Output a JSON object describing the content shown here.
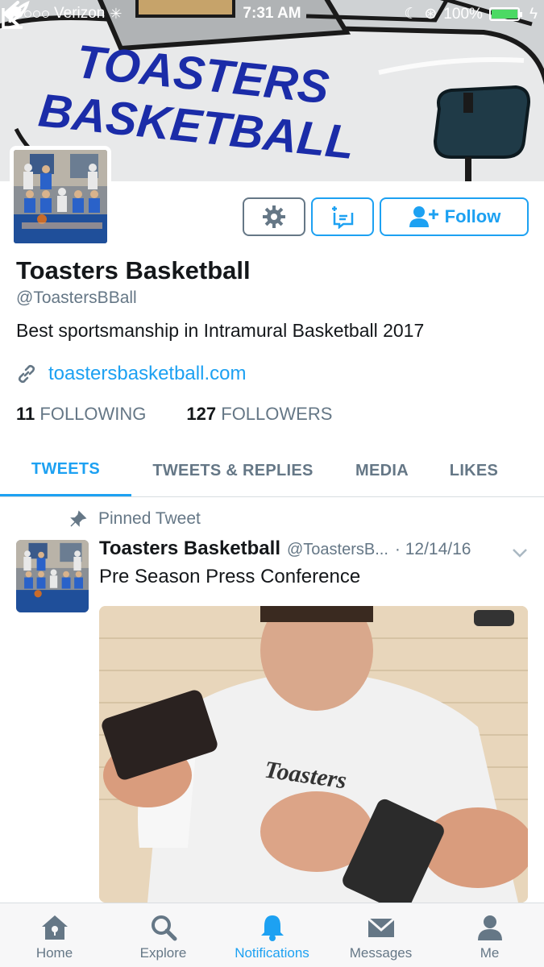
{
  "status_bar": {
    "carrier": "Verizon",
    "time": "7:31 AM",
    "battery": "100%"
  },
  "banner": {
    "line1": "TOASTERS",
    "line2": "BASKETBALL"
  },
  "profile": {
    "name": "Toasters Basketball",
    "handle": "@ToastersBBall",
    "bio": "Best sportsmanship in Intramural Basketball 2017",
    "website": "toastersbasketball.com",
    "following_count": "11",
    "following_label": "FOLLOWING",
    "followers_count": "127",
    "followers_label": "FOLLOWERS",
    "follow_label": "Follow"
  },
  "tabs": [
    {
      "label": "TWEETS",
      "active": true
    },
    {
      "label": "TWEETS & REPLIES",
      "active": false
    },
    {
      "label": "MEDIA",
      "active": false
    },
    {
      "label": "LIKES",
      "active": false
    }
  ],
  "tweet": {
    "pinned_label": "Pinned Tweet",
    "author": "Toasters Basketball",
    "handle": "@ToastersB...",
    "date": "· 12/14/16",
    "text": "Pre Season Press Conference",
    "shirt_text": "Toasters"
  },
  "bottom_nav": [
    {
      "label": "Home",
      "icon": "home-icon"
    },
    {
      "label": "Explore",
      "icon": "search-icon"
    },
    {
      "label": "Notifications",
      "icon": "bell-icon",
      "active": true
    },
    {
      "label": "Messages",
      "icon": "envelope-icon"
    },
    {
      "label": "Me",
      "icon": "person-icon"
    }
  ],
  "colors": {
    "accent": "#1da1f2",
    "muted": "#657786",
    "text": "#14171a"
  }
}
